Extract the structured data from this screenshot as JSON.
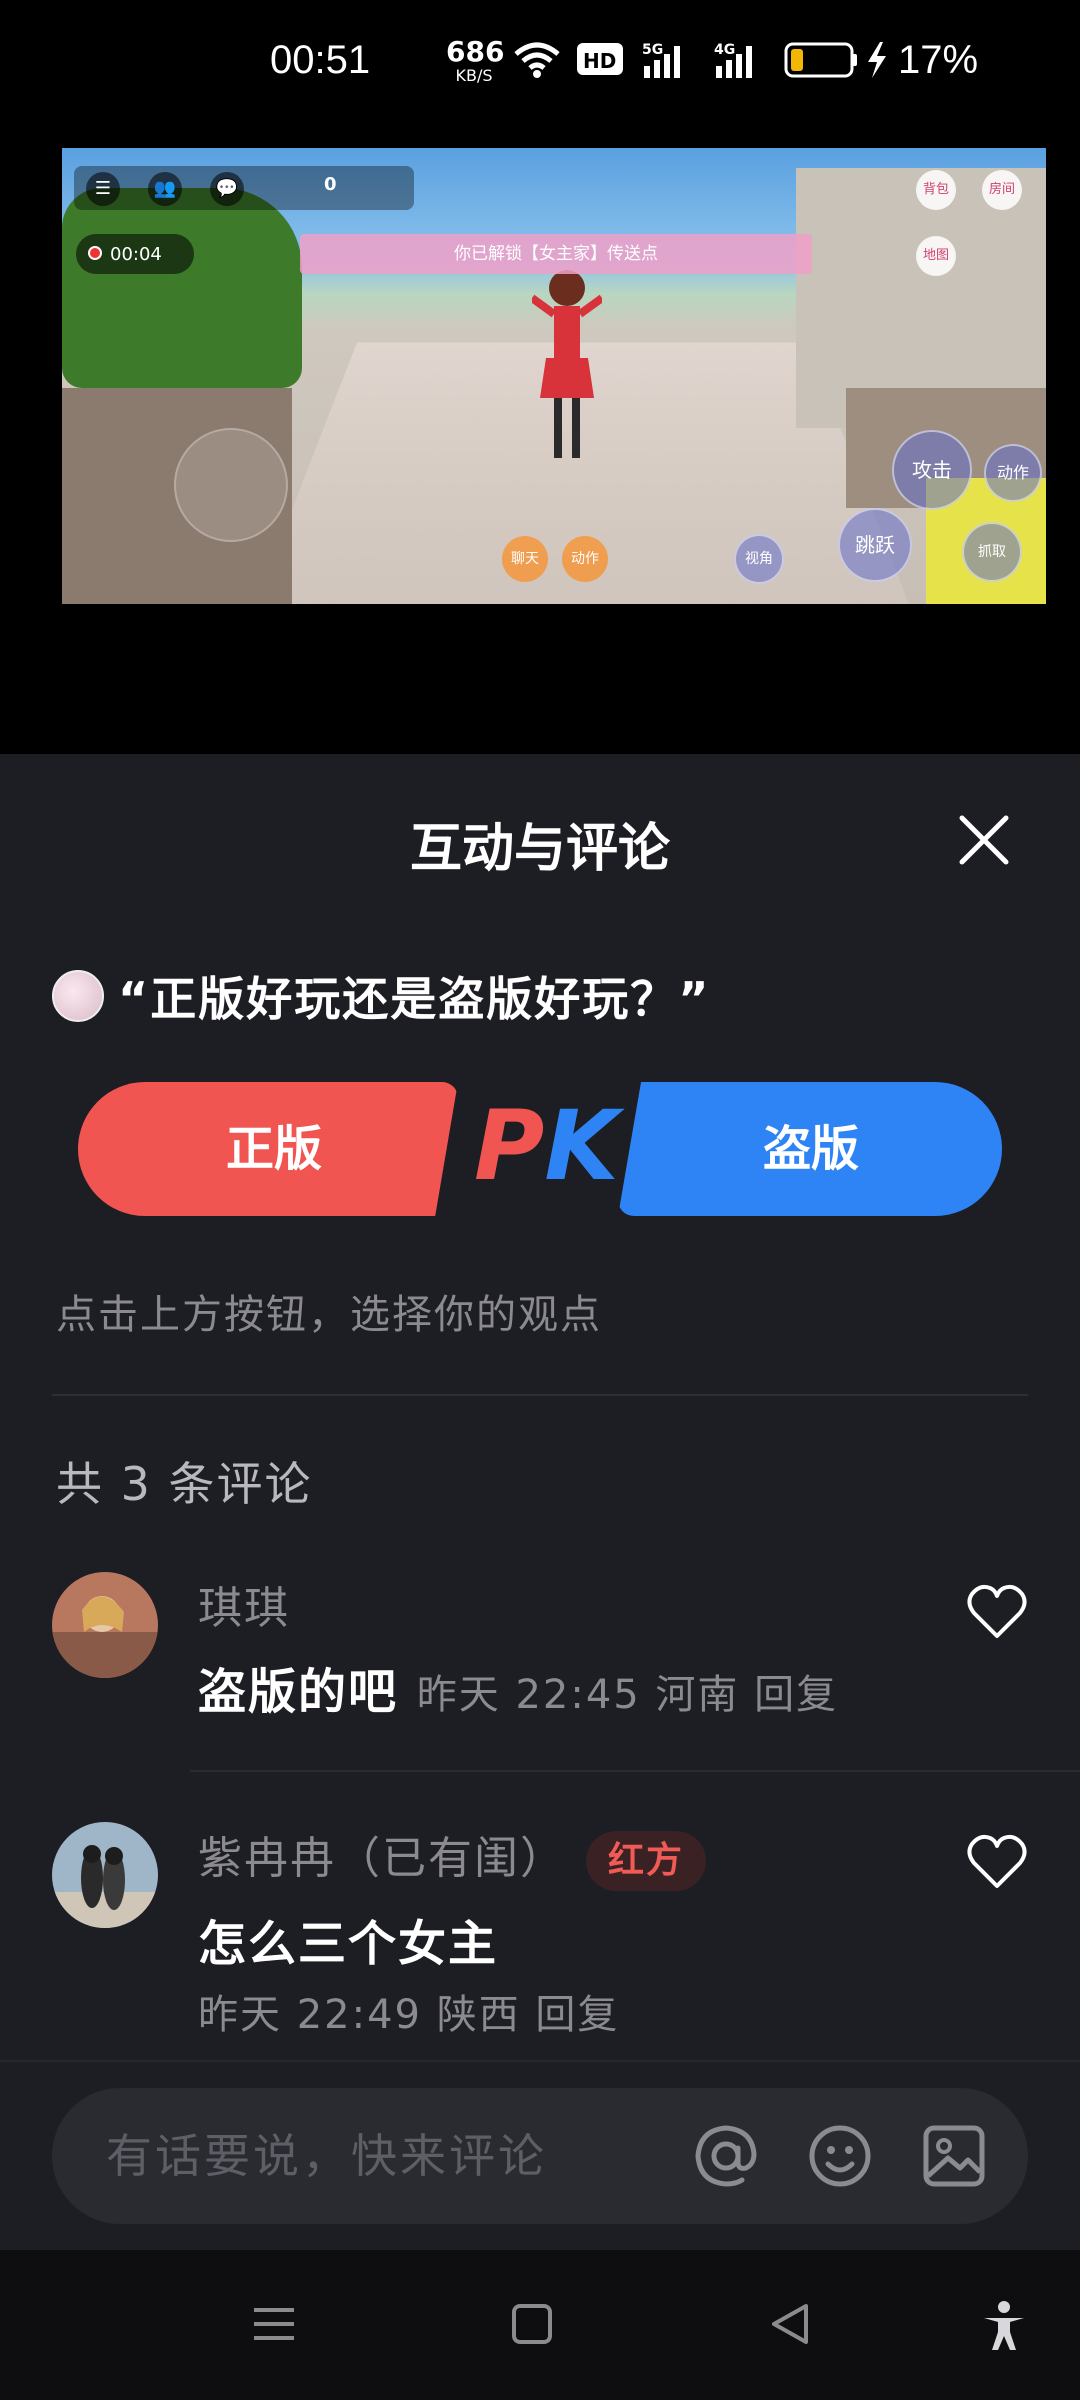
{
  "status_bar": {
    "time": "00:51",
    "net_speed_value": "686",
    "net_speed_unit": "KB/S",
    "battery_percent": "17%"
  },
  "video": {
    "coin_count": "0",
    "record_time": "00:04",
    "banner_text": "你已解锁【女主家】传送点",
    "btn_attack": "攻击",
    "btn_action": "动作",
    "btn_jump": "跳跃",
    "btn_view": "视角",
    "btn_chat": "聊天",
    "btn_action2": "动作",
    "btn_map": "地图",
    "btn_grab": "抓取",
    "btn_room": "房间",
    "btn_bag": "背包"
  },
  "sheet": {
    "title": "互动与评论",
    "question": "“正版好玩还是盗版好玩？”",
    "option_left": "正版",
    "option_right": "盗版",
    "pk_p": "P",
    "pk_k": "K",
    "hint": "点击上方按钮，选择你的观点",
    "comment_count": "共 3 条评论",
    "comments": [
      {
        "name": "琪琪",
        "text": "盗版的吧",
        "meta": "昨天 22:45 河南 回复",
        "badge": ""
      },
      {
        "name": "紫冉冉（已有闺）",
        "badge": "红方",
        "text": "怎么三个女主",
        "meta": "昨天 22:49 陕西 回复"
      }
    ]
  },
  "input": {
    "placeholder": "有话要说，快来评论"
  },
  "colors": {
    "red": "#f05552",
    "blue": "#2f84f5",
    "sheet_bg": "#1d1d24"
  }
}
